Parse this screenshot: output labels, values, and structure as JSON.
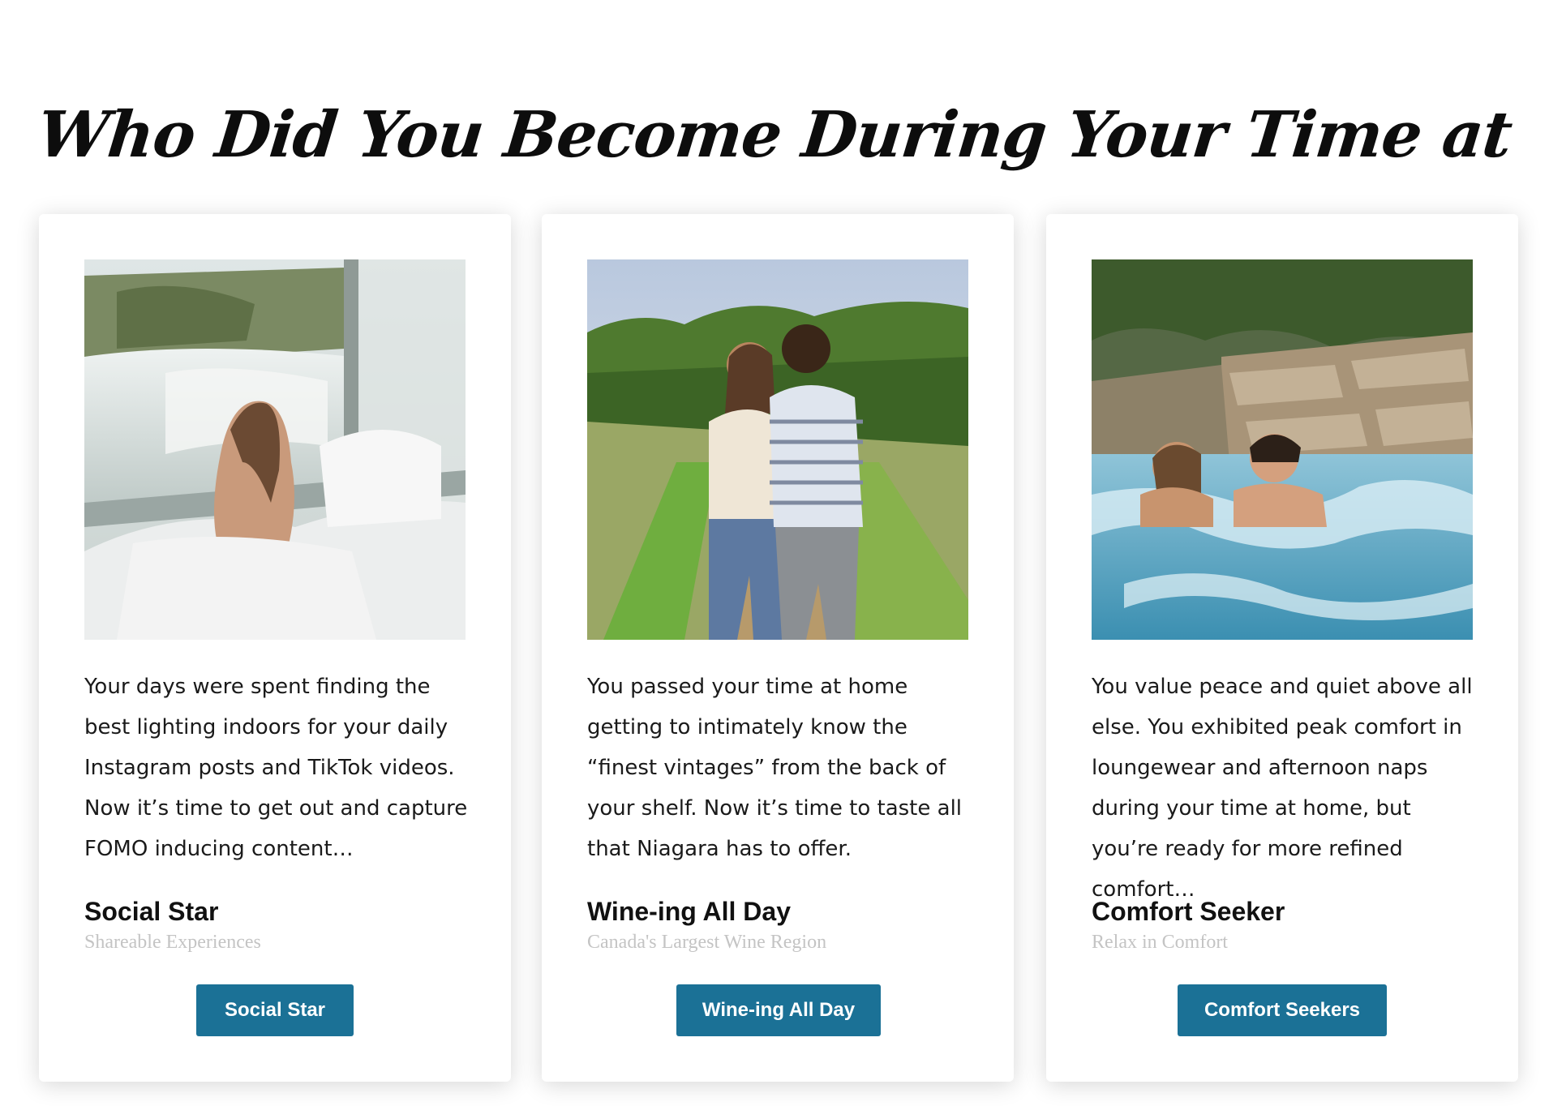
{
  "page": {
    "headline": "Who Did You Become During Your Time at Home?"
  },
  "colors": {
    "button_bg": "#1b7196",
    "button_text": "#ffffff",
    "subtitle_text": "#c4c4c4"
  },
  "cards": [
    {
      "image_icon": "photo-hotel-bed-falls-view",
      "description": "Your days were spent finding the best lighting indoors for your daily Instagram posts and TikTok videos. Now it’s time to get out and capture FOMO inducing content…",
      "title": "Social Star",
      "subtitle": "Shareable Experiences",
      "button_label": "Social Star"
    },
    {
      "image_icon": "photo-couple-vineyard",
      "description": "You passed your time at home getting to intimately know the “finest vintages” from the back of your shelf. Now it’s time to taste all that Niagara has to offer.",
      "title": "Wine-ing All Day",
      "subtitle": "Canada's Largest Wine Region",
      "button_label": "Wine-ing All Day"
    },
    {
      "image_icon": "photo-couple-hot-tub",
      "description": "You value peace and quiet above all else. You exhibited peak comfort in loungewear and afternoon naps during your time at home, but you’re ready for more refined comfort…",
      "title": "Comfort Seeker",
      "subtitle": "Relax in Comfort",
      "button_label": "Comfort Seekers"
    }
  ]
}
